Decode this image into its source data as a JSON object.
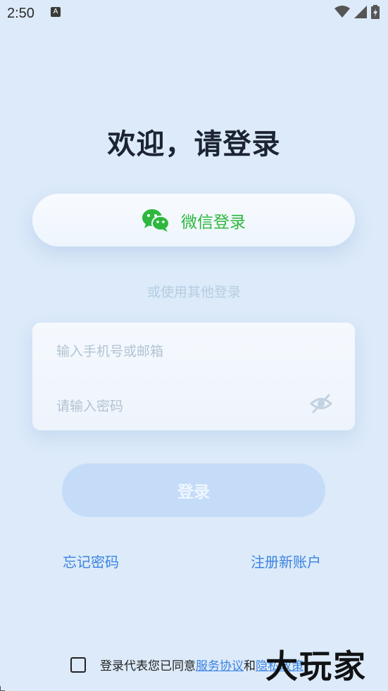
{
  "status_bar": {
    "time": "2:50",
    "notification_icon": "a-icon"
  },
  "page": {
    "title": "欢迎，请登录"
  },
  "wechat_login": {
    "label": "微信登录",
    "icon": "wechat-icon",
    "color": "#2db83d"
  },
  "divider": {
    "text": "或使用其他登录"
  },
  "form": {
    "account_placeholder": "输入手机号或邮箱",
    "password_placeholder": "请输入密码",
    "toggle_icon": "eye-hidden-icon"
  },
  "login_button": {
    "label": "登录"
  },
  "links": {
    "forgot": "忘记密码",
    "register": "注册新账户"
  },
  "agreement": {
    "prefix": "登录代表您已同意",
    "service": "服务协议",
    "and": "和",
    "privacy": "隐私政策"
  },
  "watermark": {
    "text": "大玩家"
  },
  "colors": {
    "background": "#dceaf9",
    "accent": "#3b83e0",
    "button_disabled": "#c4dcf8"
  }
}
